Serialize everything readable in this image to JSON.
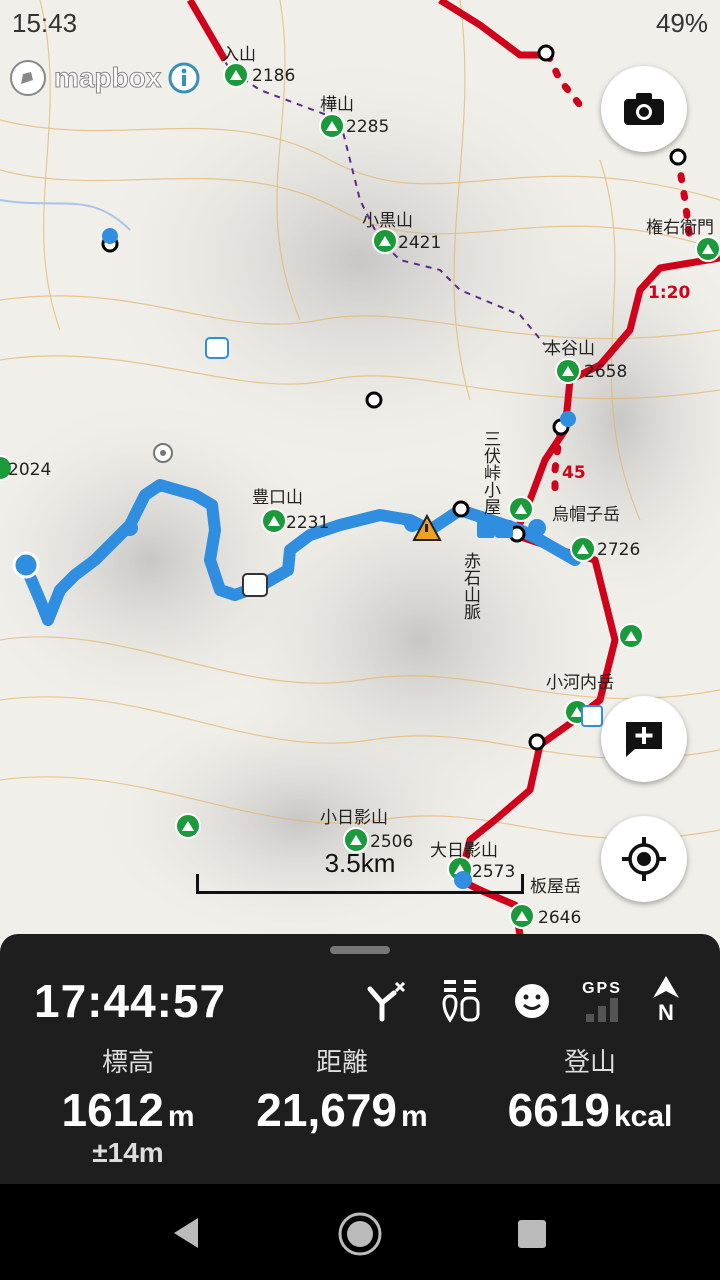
{
  "status_bar": {
    "time": "15:43",
    "battery": "49%"
  },
  "map": {
    "attribution": "mapbox",
    "scale_label": "3.5km",
    "labels": [
      "入山",
      "2186",
      "樺山",
      "2285",
      "小黒山",
      "2421",
      "権右衛門",
      "本谷山",
      "2658",
      "三伏峠小屋",
      "烏帽子岳",
      "2726",
      "45",
      "1:20",
      "豊口山",
      "2231",
      "赤石山脈",
      "小河内岳",
      "小日影山",
      "2506",
      "大日影山",
      "2573",
      "板屋岳",
      "2646",
      "2024"
    ]
  },
  "panel": {
    "clock": "17:44:57",
    "gps_label": "GPS",
    "north_label": "N",
    "stats": [
      {
        "label": "標高",
        "value": "1612",
        "unit": "m",
        "sub": "±14m"
      },
      {
        "label": "距離",
        "value": "21,679",
        "unit": "m"
      },
      {
        "label": "登山",
        "value": "6619",
        "unit": "kcal"
      }
    ]
  },
  "colors": {
    "route": "#d0021b",
    "track": "#2f8ee0",
    "panel": "#1e1e1e",
    "peak": "#1a9a3a"
  }
}
